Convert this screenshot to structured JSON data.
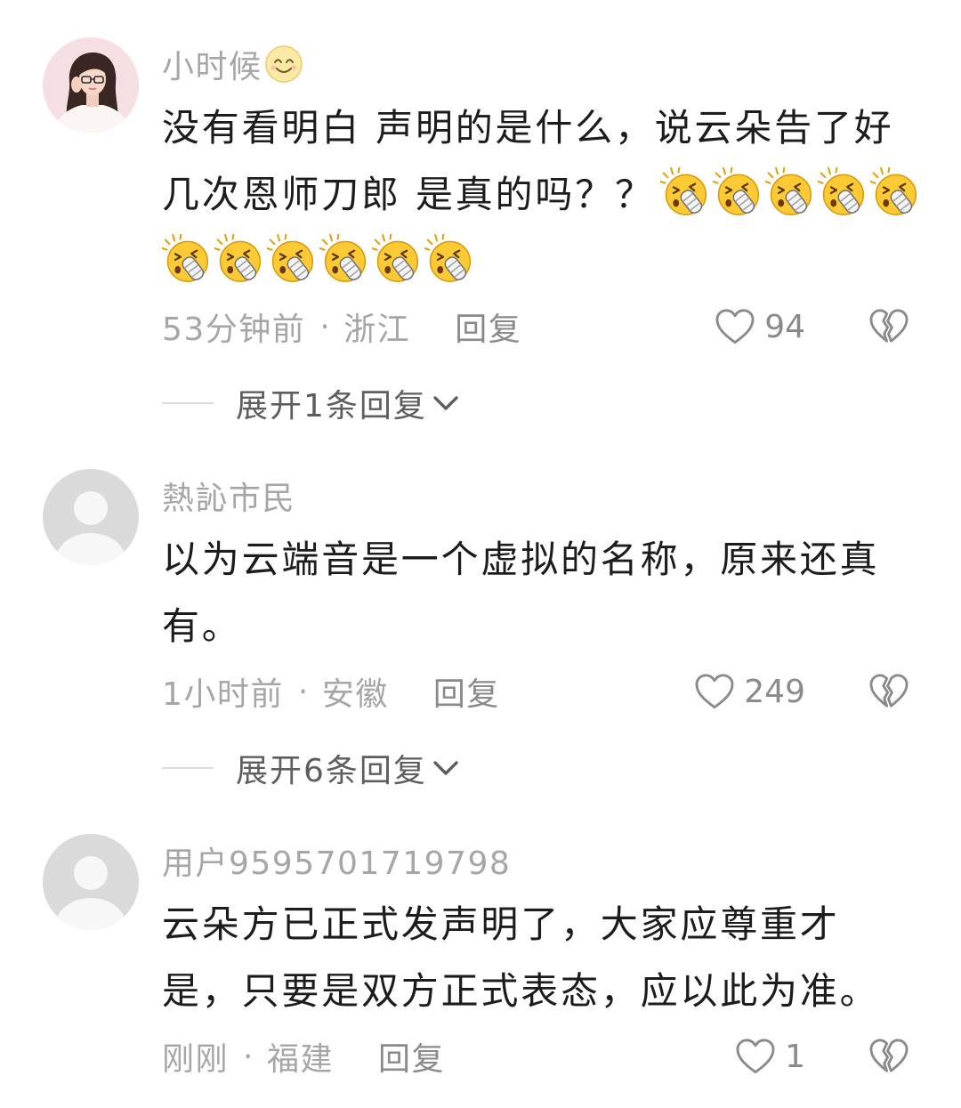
{
  "colors": {
    "background": "#ffffff",
    "text_primary": "#1c1c1c",
    "text_secondary": "#a6a6a6",
    "action_gray": "#8a8a8a",
    "expand_text": "#5e5e5e",
    "divider": "#dcdcdc"
  },
  "comments": [
    {
      "avatar": "woman-photo-avatar",
      "username": "小时候",
      "username_emoji": "smiling-face-emoji",
      "lines": [
        {
          "text": "没有看明白 声明的是什么，说云朵告了好",
          "emojis": []
        },
        {
          "text": "几次恩师刀郎 是真的吗？？",
          "emojis": [
            "shocked-face-emoji",
            "shocked-face-emoji",
            "shocked-face-emoji",
            "shocked-face-emoji",
            "shocked-face-emoji"
          ]
        },
        {
          "text": "",
          "emojis": [
            "shocked-face-emoji",
            "shocked-face-emoji",
            "shocked-face-emoji",
            "shocked-face-emoji",
            "shocked-face-emoji",
            "shocked-face-emoji"
          ]
        }
      ],
      "time": "53分钟前",
      "separator": "·",
      "location": "浙江",
      "reply_label": "回复",
      "like_icon": "heart-outline-icon",
      "like_count": "94",
      "dislike_icon": "broken-heart-icon",
      "expand_label": "展开1条回复",
      "expand_icon": "chevron-down-icon"
    },
    {
      "avatar": "default-avatar",
      "username": "熱訫市民",
      "lines": [
        {
          "text": "以为云端音是一个虚拟的名称，原来还真",
          "emojis": []
        },
        {
          "text": "有。",
          "emojis": []
        }
      ],
      "time": "1小时前",
      "separator": "·",
      "location": "安徽",
      "reply_label": "回复",
      "like_icon": "heart-outline-icon",
      "like_count": "249",
      "dislike_icon": "broken-heart-icon",
      "expand_label": "展开6条回复",
      "expand_icon": "chevron-down-icon"
    },
    {
      "avatar": "default-avatar",
      "username": "用户9595701719798",
      "lines": [
        {
          "text": "云朵方已正式发声明了，大家应尊重才",
          "emojis": []
        },
        {
          "text": "是，只要是双方正式表态，应以此为准。",
          "emojis": []
        }
      ],
      "time": "刚刚",
      "separator": "·",
      "location": "福建",
      "reply_label": "回复",
      "like_icon": "heart-outline-icon",
      "like_count": "1",
      "dislike_icon": "broken-heart-icon"
    }
  ]
}
